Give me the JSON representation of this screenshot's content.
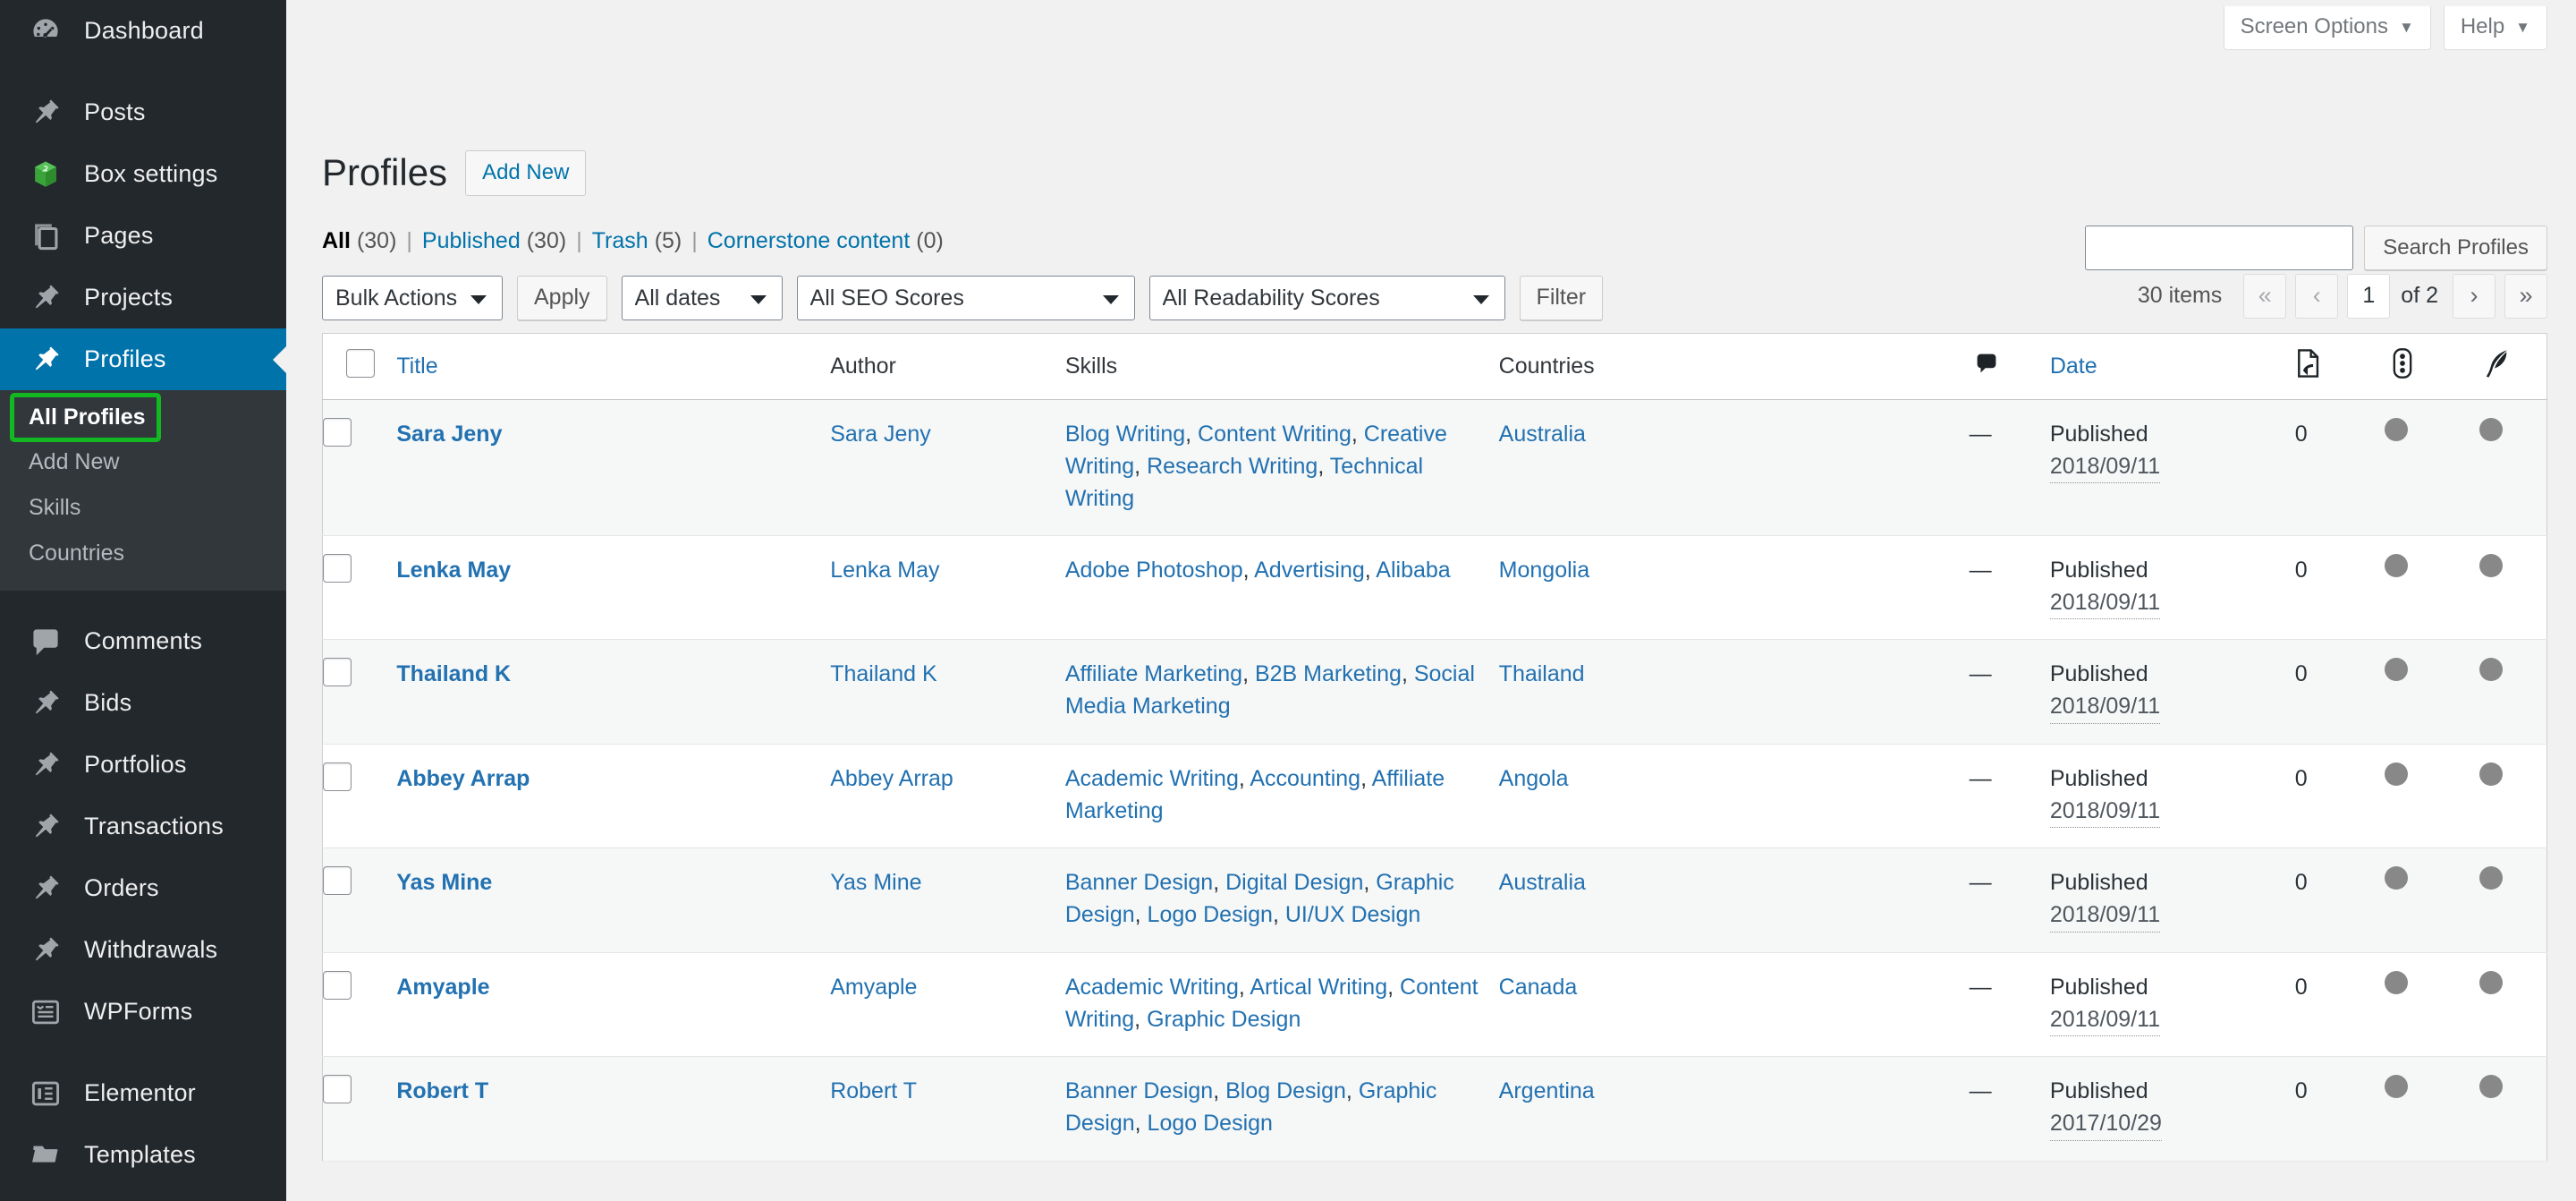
{
  "sidebar": {
    "items": [
      {
        "label": "Dashboard",
        "icon": "dashboard-icon",
        "current": false
      },
      {
        "label": "Posts",
        "icon": "pin-icon",
        "current": false
      },
      {
        "label": "Box settings",
        "icon": "box-icon",
        "current": false
      },
      {
        "label": "Pages",
        "icon": "pages-icon",
        "current": false
      },
      {
        "label": "Projects",
        "icon": "pin-icon",
        "current": false
      },
      {
        "label": "Profiles",
        "icon": "pin-icon",
        "current": true
      },
      {
        "label": "Comments",
        "icon": "comment-icon",
        "current": false
      },
      {
        "label": "Bids",
        "icon": "pin-icon",
        "current": false
      },
      {
        "label": "Portfolios",
        "icon": "pin-icon",
        "current": false
      },
      {
        "label": "Transactions",
        "icon": "pin-icon",
        "current": false
      },
      {
        "label": "Orders",
        "icon": "pin-icon",
        "current": false
      },
      {
        "label": "Withdrawals",
        "icon": "pin-icon",
        "current": false
      },
      {
        "label": "WPForms",
        "icon": "wpforms-icon",
        "current": false
      },
      {
        "label": "Elementor",
        "icon": "elementor-icon",
        "current": false
      },
      {
        "label": "Templates",
        "icon": "folder-icon",
        "current": false
      }
    ],
    "submenu": [
      {
        "label": "All Profiles",
        "current": true,
        "highlighted": true
      },
      {
        "label": "Add New",
        "current": false,
        "highlighted": false
      },
      {
        "label": "Skills",
        "current": false,
        "highlighted": false
      },
      {
        "label": "Countries",
        "current": false,
        "highlighted": false
      }
    ],
    "highlight_color": "#12b822",
    "active_color": "#0073aa",
    "background": "#23282d",
    "submenu_background": "#32373c"
  },
  "screen_meta": {
    "screen_options_label": "Screen Options",
    "help_label": "Help",
    "caret": "▼"
  },
  "header": {
    "title": "Profiles",
    "add_new_label": "Add New"
  },
  "views": [
    {
      "label": "All",
      "count": "(30)",
      "current": true
    },
    {
      "label": "Published",
      "count": "(30)",
      "current": false
    },
    {
      "label": "Trash",
      "count": "(5)",
      "current": false
    },
    {
      "label": "Cornerstone content",
      "count": "(0)",
      "current": false
    }
  ],
  "search": {
    "value": "",
    "placeholder": "",
    "submit_label": "Search Profiles"
  },
  "toolbar": {
    "bulk_actions_selected": "Bulk Actions",
    "apply_label": "Apply",
    "dates_selected": "All dates",
    "seo_selected": "All SEO Scores",
    "readability_selected": "All Readability Scores",
    "filter_label": "Filter"
  },
  "pagination": {
    "items_label": "30 items",
    "first": "«",
    "prev": "‹",
    "current_page": "1",
    "of_label": "of 2",
    "next": "›",
    "last": "»"
  },
  "table": {
    "columns": {
      "title": "Title",
      "author": "Author",
      "skills": "Skills",
      "countries": "Countries",
      "comments_icon": "comment-icon",
      "date": "Date",
      "links_icon": "incoming-links-icon",
      "seo_icon": "seo-score-icon",
      "readability_icon": "readability-feather-icon"
    },
    "rows": [
      {
        "title": "Sara Jeny",
        "author": "Sara Jeny",
        "skills": [
          "Blog Writing",
          "Content Writing",
          "Creative Writing",
          "Research Writing",
          "Technical Writing"
        ],
        "countries": [
          "Australia"
        ],
        "comments": "—",
        "status": "Published",
        "date": "2018/09/11",
        "links": "0",
        "seo_score": "#888888",
        "readability_score": "#888888"
      },
      {
        "title": "Lenka May",
        "author": "Lenka May",
        "skills": [
          "Adobe Photoshop",
          "Advertising",
          "Alibaba"
        ],
        "countries": [
          "Mongolia"
        ],
        "comments": "—",
        "status": "Published",
        "date": "2018/09/11",
        "links": "0",
        "seo_score": "#888888",
        "readability_score": "#888888"
      },
      {
        "title": "Thailand K",
        "author": "Thailand K",
        "skills": [
          "Affiliate Marketing",
          "B2B Marketing",
          "Social Media Marketing"
        ],
        "countries": [
          "Thailand"
        ],
        "comments": "—",
        "status": "Published",
        "date": "2018/09/11",
        "links": "0",
        "seo_score": "#888888",
        "readability_score": "#888888"
      },
      {
        "title": "Abbey Arrap",
        "author": "Abbey Arrap",
        "skills": [
          "Academic Writing",
          "Accounting",
          "Affiliate Marketing"
        ],
        "countries": [
          "Angola"
        ],
        "comments": "—",
        "status": "Published",
        "date": "2018/09/11",
        "links": "0",
        "seo_score": "#888888",
        "readability_score": "#888888"
      },
      {
        "title": "Yas Mine",
        "author": "Yas Mine",
        "skills": [
          "Banner Design",
          "Digital Design",
          "Graphic Design",
          "Logo Design",
          "UI/UX Design"
        ],
        "countries": [
          "Australia"
        ],
        "comments": "—",
        "status": "Published",
        "date": "2018/09/11",
        "links": "0",
        "seo_score": "#888888",
        "readability_score": "#888888"
      },
      {
        "title": "Amyaple",
        "author": "Amyaple",
        "skills": [
          "Academic Writing",
          "Artical Writing",
          "Content Writing",
          "Graphic Design"
        ],
        "countries": [
          "Canada"
        ],
        "comments": "—",
        "status": "Published",
        "date": "2018/09/11",
        "links": "0",
        "seo_score": "#888888",
        "readability_score": "#888888"
      },
      {
        "title": "Robert T",
        "author": "Robert T",
        "skills": [
          "Banner Design",
          "Blog Design",
          "Graphic Design",
          "Logo Design"
        ],
        "countries": [
          "Argentina"
        ],
        "comments": "—",
        "status": "Published",
        "date": "2017/10/29",
        "links": "0",
        "seo_score": "#888888",
        "readability_score": "#888888"
      }
    ]
  }
}
